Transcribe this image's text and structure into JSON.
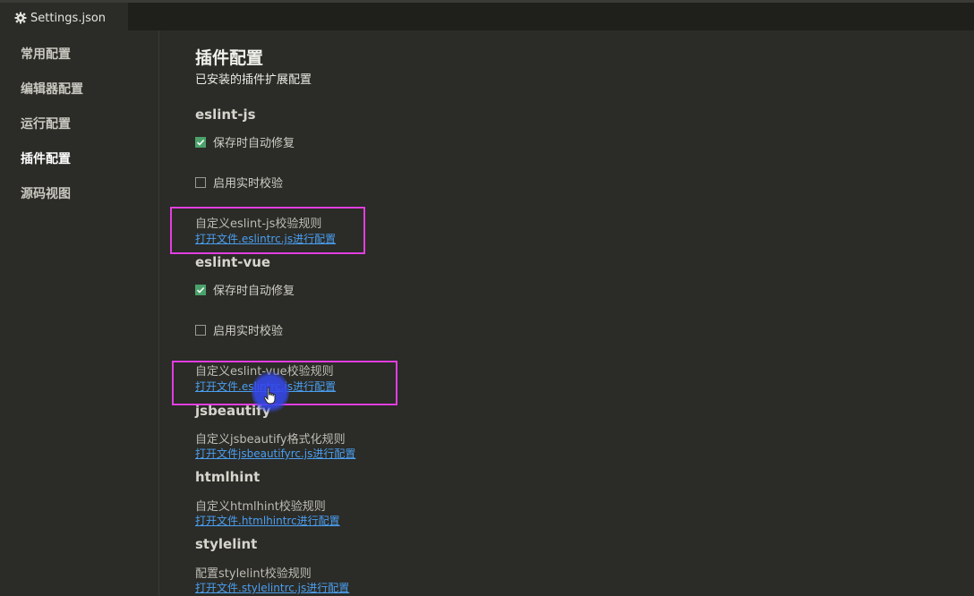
{
  "tab": {
    "title": "Settings.json",
    "icon": "gear-icon"
  },
  "sidebar": {
    "items": [
      {
        "label": "常用配置"
      },
      {
        "label": "编辑器配置"
      },
      {
        "label": "运行配置"
      },
      {
        "label": "插件配置",
        "active": true
      },
      {
        "label": "源码视图"
      }
    ]
  },
  "main": {
    "title": "插件配置",
    "subtitle": "已安装的插件扩展配置",
    "sections": [
      {
        "name": "eslint-js",
        "options": [
          {
            "label": "保存时自动修复",
            "checked": true
          },
          {
            "label": "启用实时校验",
            "checked": false
          }
        ],
        "desc": "自定义eslint-js校验规则",
        "link": "打开文件.eslintrc.js进行配置"
      },
      {
        "name": "eslint-vue",
        "options": [
          {
            "label": "保存时自动修复",
            "checked": true
          },
          {
            "label": "启用实时校验",
            "checked": false
          }
        ],
        "desc": "自定义eslint-vue校验规则",
        "link": "打开文件.eslintrc.js进行配置"
      },
      {
        "name": "jsbeautify",
        "desc": "自定义jsbeautify格式化规则",
        "link": "打开文件jsbeautifyrc.js进行配置"
      },
      {
        "name": "htmlhint",
        "desc": "自定义htmlhint校验规则",
        "link": "打开文件.htmlhintrc进行配置"
      },
      {
        "name": "stylelint",
        "desc": "配置stylelint校验规则",
        "link": "打开文件.stylelintrc.js进行配置"
      }
    ]
  },
  "colors": {
    "accent_link": "#4a9ff0",
    "checkbox_checked": "#4aa26a",
    "highlight_box": "#e23ee0",
    "cursor_blob": "#3448eb"
  }
}
